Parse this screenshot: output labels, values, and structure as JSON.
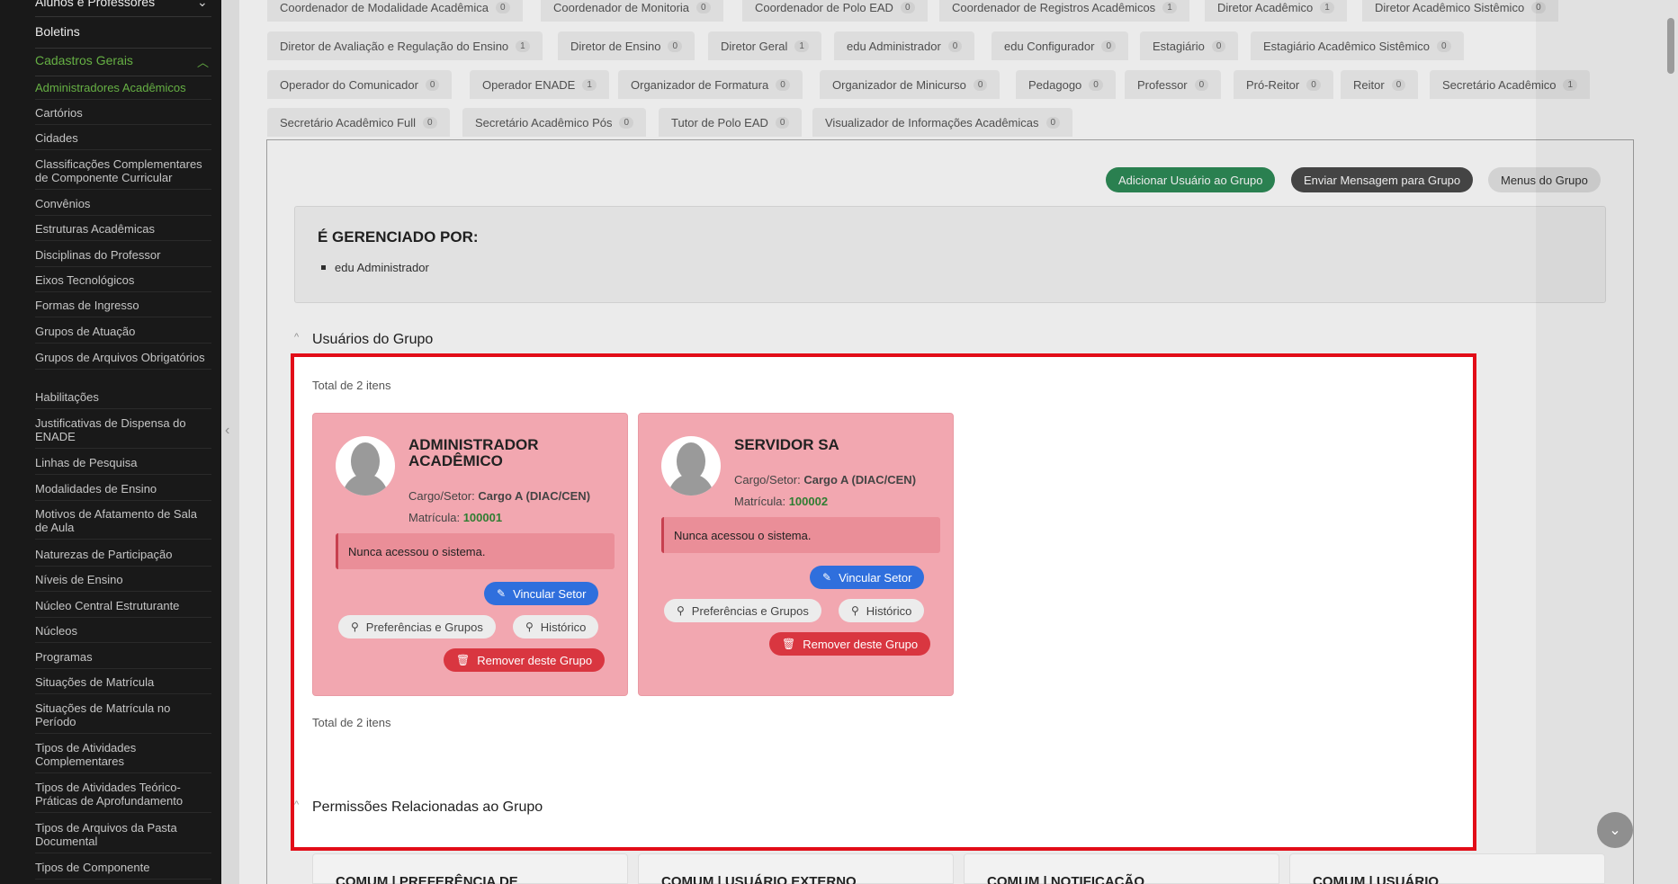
{
  "sidebar": {
    "top_items": [
      "Alunos e Professores",
      "Boletins"
    ],
    "category": "Cadastros Gerais",
    "items": [
      "Administradores Acadêmicos",
      "Cartórios",
      "Cidades",
      "Classificações Complementares de Componente Curricular",
      "Convênios",
      "Estruturas Acadêmicas",
      "Disciplinas do Professor",
      "Eixos Tecnológicos",
      "Formas de Ingresso",
      "Grupos de Atuação",
      "Grupos de Arquivos Obrigatórios",
      "Habilitações",
      "Justificativas de Dispensa do ENADE",
      "Linhas de Pesquisa",
      "Modalidades de Ensino",
      "Motivos de Afatamento de Sala de Aula",
      "Naturezas de Participação",
      "Níveis de Ensino",
      "Núcleo Central Estruturante",
      "Núcleos",
      "Programas",
      "Situações de Matrícula",
      "Situações de Matrícula no Período",
      "Tipos de Atividades Complementares",
      "Tipos de Atividades Teórico-Práticas de Aprofundamento",
      "Tipos de Arquivos da Pasta Documental",
      "Tipos de Componente"
    ]
  },
  "tabs": [
    {
      "label": "Coordenador de Modalidade Acadêmica",
      "count": "0"
    },
    {
      "label": "Coordenador de Monitoria",
      "count": "0"
    },
    {
      "label": "Coordenador de Polo EAD",
      "count": "0"
    },
    {
      "label": "Coordenador de Registros Acadêmicos",
      "count": "1"
    },
    {
      "label": "Diretor Acadêmico",
      "count": "1"
    },
    {
      "label": "Diretor Acadêmico Sistêmico",
      "count": "0"
    },
    {
      "label": "Diretor de Avaliação e Regulação do Ensino",
      "count": "1"
    },
    {
      "label": "Diretor de Ensino",
      "count": "0"
    },
    {
      "label": "Diretor Geral",
      "count": "1"
    },
    {
      "label": "edu Administrador",
      "count": "0"
    },
    {
      "label": "edu Configurador",
      "count": "0"
    },
    {
      "label": "Estagiário",
      "count": "0"
    },
    {
      "label": "Estagiário Acadêmico Sistêmico",
      "count": "0"
    },
    {
      "label": "Operador do Comunicador",
      "count": "0"
    },
    {
      "label": "Operador ENADE",
      "count": "1"
    },
    {
      "label": "Organizador de Formatura",
      "count": "0"
    },
    {
      "label": "Organizador de Minicurso",
      "count": "0"
    },
    {
      "label": "Pedagogo",
      "count": "0"
    },
    {
      "label": "Professor",
      "count": "0"
    },
    {
      "label": "Pró-Reitor",
      "count": "0"
    },
    {
      "label": "Reitor",
      "count": "0"
    },
    {
      "label": "Secretário Acadêmico",
      "count": "1"
    },
    {
      "label": "Secretário Acadêmico Full",
      "count": "0"
    },
    {
      "label": "Secretário Acadêmico Pós",
      "count": "0"
    },
    {
      "label": "Tutor de Polo EAD",
      "count": "0"
    },
    {
      "label": "Visualizador de Informações Acadêmicas",
      "count": "0"
    }
  ],
  "actions": {
    "add_user": "Adicionar Usuário ao Grupo",
    "send_message": "Enviar Mensagem para Grupo",
    "group_menus": "Menus do Grupo"
  },
  "managed": {
    "title": "É GERENCIADO POR:",
    "items": [
      "edu Administrador"
    ]
  },
  "users_section": {
    "title": "Usuários do Grupo",
    "total_top": "Total de 2 itens",
    "total_bottom": "Total de 2 itens",
    "cargo_label": "Cargo/Setor:",
    "matricula_label": "Matrícula:",
    "users": [
      {
        "name": "ADMINISTRADOR ACADÊMICO",
        "cargo": "Cargo A (DIAC/CEN)",
        "matricula": "100001",
        "status": "Nunca acessou o sistema.",
        "link_sector": "Vincular Setor",
        "preferences": "Preferências e Grupos",
        "history": "Histórico",
        "remove": "Remover deste Grupo"
      },
      {
        "name": "SERVIDOR SA",
        "cargo": "Cargo A (DIAC/CEN)",
        "matricula": "100002",
        "status": "Nunca acessou o sistema.",
        "link_sector": "Vincular Setor",
        "preferences": "Preferências e Grupos",
        "history": "Histórico",
        "remove": "Remover deste Grupo"
      }
    ]
  },
  "permissions_section": {
    "title": "Permissões Relacionadas ao Grupo",
    "cards": [
      "COMUM | PREFERÊNCIA DE",
      "COMUM | USUÁRIO EXTERNO",
      "COMUM | NOTIFICAÇÃO",
      "COMUM | USUÁRIO"
    ]
  },
  "colors": {
    "sidebar_bg": "#1c1c1c",
    "accent_green": "#6fbf4a",
    "card_bg": "#f2a7b0",
    "highlight_border": "#e20d18",
    "primary_button": "#2f6fdd",
    "danger_button": "#d93640",
    "success_button": "#2e8b57"
  }
}
